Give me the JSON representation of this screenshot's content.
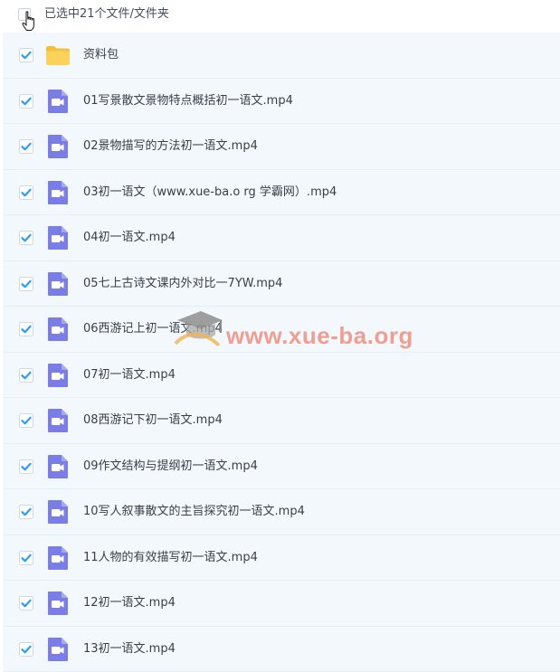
{
  "header": {
    "selection_text": "已选中21个文件/文件夹"
  },
  "files": [
    {
      "name": "资料包",
      "type": "folder"
    },
    {
      "name": "01写景散文景物特点概括初一语文.mp4",
      "type": "video"
    },
    {
      "name": "02景物描写的方法初一语文.mp4",
      "type": "video"
    },
    {
      "name": "03初一语文（www.xue-ba.o rg 学霸网）.mp4",
      "type": "video"
    },
    {
      "name": "04初一语文.mp4",
      "type": "video"
    },
    {
      "name": "05七上古诗文课内外对比一7YW.mp4",
      "type": "video"
    },
    {
      "name": "06西游记上初一语文.mp4",
      "type": "video"
    },
    {
      "name": "07初一语文.mp4",
      "type": "video"
    },
    {
      "name": "08西游记下初一语文.mp4",
      "type": "video"
    },
    {
      "name": "09作文结构与提纲初一语文.mp4",
      "type": "video"
    },
    {
      "name": "10写人叙事散文的主旨探究初一语文.mp4",
      "type": "video"
    },
    {
      "name": "11人物的有效描写初一语文.mp4",
      "type": "video"
    },
    {
      "name": "12初一语文.mp4",
      "type": "video"
    },
    {
      "name": "13初一语文.mp4",
      "type": "video"
    }
  ],
  "watermark": {
    "text": "www.xue-ba.org"
  },
  "colors": {
    "check": "#2a9df4",
    "video_icon": "#7b7de6",
    "folder": "#f7c744",
    "row_bg": "#f3f8fd"
  }
}
